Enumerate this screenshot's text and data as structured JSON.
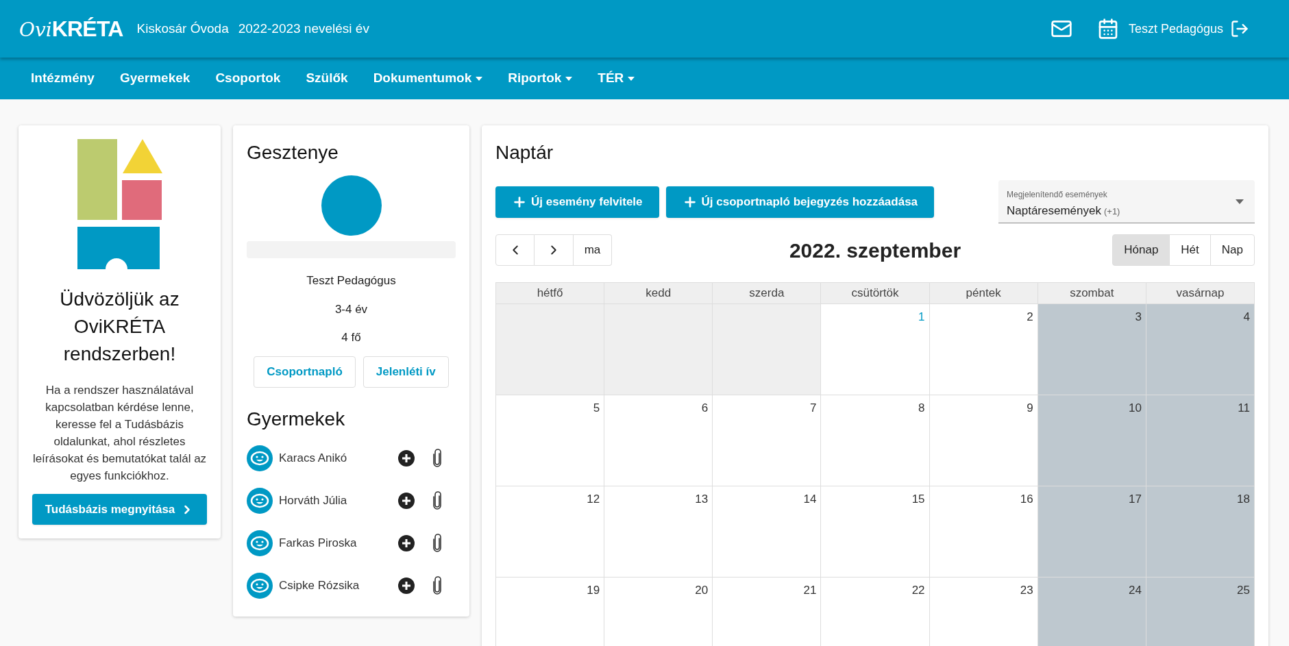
{
  "header": {
    "logo": {
      "script": "Ovi",
      "word": "KRÉTA"
    },
    "institution": "Kiskosár Óvoda",
    "year": "2022-2023 nevelési év",
    "user": "Teszt Pedagógus"
  },
  "nav": [
    {
      "label": "Intézmény",
      "dropdown": false
    },
    {
      "label": "Gyermekek",
      "dropdown": false
    },
    {
      "label": "Csoportok",
      "dropdown": false
    },
    {
      "label": "Szülők",
      "dropdown": false
    },
    {
      "label": "Dokumentumok",
      "dropdown": true
    },
    {
      "label": "Riportok",
      "dropdown": true
    },
    {
      "label": "TÉR",
      "dropdown": true
    }
  ],
  "welcome": {
    "title": "Üdvözöljük az OviKRÉTA rendszerben!",
    "text": "Ha a rendszer használatával kapcsolatban kérdése lenne, keresse fel a Tudásbázis oldalunkat, ahol részletes leírásokat és bemutatókat talál az egyes funkciókhoz.",
    "button": "Tudásbázis megnyitása"
  },
  "group": {
    "title": "Gesztenye",
    "teacher": "Teszt Pedagógus",
    "age": "3-4 év",
    "count": "4 fő",
    "buttons": [
      "Csoportnapló",
      "Jelenléti ív"
    ],
    "children_title": "Gyermekek",
    "children": [
      {
        "name": "Karacs Anikó"
      },
      {
        "name": "Horváth Júlia"
      },
      {
        "name": "Farkas Piroska"
      },
      {
        "name": "Csipke Rózsika"
      }
    ]
  },
  "calendar": {
    "title": "Naptár",
    "actions": [
      "Új esemény felvitele",
      "Új csoportnapló bejegyzés hozzáadása"
    ],
    "filter": {
      "label": "Megjelenítendő események",
      "value": "Naptáresemények",
      "extra": "(+1)"
    },
    "today_button": "ma",
    "month": "2022. szeptember",
    "views": [
      {
        "label": "Hónap",
        "selected": true
      },
      {
        "label": "Hét",
        "selected": false
      },
      {
        "label": "Nap",
        "selected": false
      }
    ],
    "weekdays": [
      "hétfő",
      "kedd",
      "szerda",
      "csütörtök",
      "péntek",
      "szombat",
      "vasárnap"
    ],
    "weeks": [
      [
        {
          "kind": "outside"
        },
        {
          "kind": "outside"
        },
        {
          "kind": "outside"
        },
        {
          "day": "1",
          "kind": "weekday",
          "today": true
        },
        {
          "day": "2",
          "kind": "weekday",
          "today": false
        },
        {
          "day": "3",
          "kind": "weekend",
          "today": false
        },
        {
          "day": "4",
          "kind": "weekend",
          "today": false
        }
      ],
      [
        {
          "day": "5",
          "kind": "weekday",
          "today": false
        },
        {
          "day": "6",
          "kind": "weekday",
          "today": false
        },
        {
          "day": "7",
          "kind": "weekday",
          "today": false
        },
        {
          "day": "8",
          "kind": "weekday",
          "today": false
        },
        {
          "day": "9",
          "kind": "weekday",
          "today": false
        },
        {
          "day": "10",
          "kind": "weekend",
          "today": false
        },
        {
          "day": "11",
          "kind": "weekend",
          "today": false
        }
      ],
      [
        {
          "day": "12",
          "kind": "weekday",
          "today": false
        },
        {
          "day": "13",
          "kind": "weekday",
          "today": false
        },
        {
          "day": "14",
          "kind": "weekday",
          "today": false
        },
        {
          "day": "15",
          "kind": "weekday",
          "today": false
        },
        {
          "day": "16",
          "kind": "weekday",
          "today": false
        },
        {
          "day": "17",
          "kind": "weekend",
          "today": false
        },
        {
          "day": "18",
          "kind": "weekend",
          "today": false
        }
      ],
      [
        {
          "day": "19",
          "kind": "weekday",
          "today": false
        },
        {
          "day": "20",
          "kind": "weekday",
          "today": false
        },
        {
          "day": "21",
          "kind": "weekday",
          "today": false
        },
        {
          "day": "22",
          "kind": "weekday",
          "today": false
        },
        {
          "day": "23",
          "kind": "weekday",
          "today": false
        },
        {
          "day": "24",
          "kind": "weekend",
          "today": false
        },
        {
          "day": "25",
          "kind": "weekend",
          "today": false
        }
      ]
    ]
  }
}
